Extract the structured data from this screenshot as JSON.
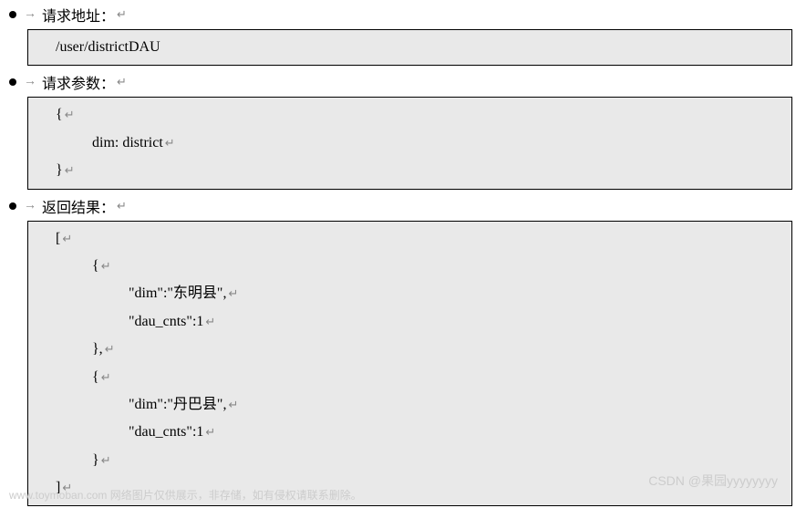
{
  "sections": [
    {
      "title": "请求地址：",
      "lines": [
        {
          "indent": 1,
          "text": "/user/districtDAU",
          "mark": ""
        }
      ]
    },
    {
      "title": "请求参数：",
      "lines": [
        {
          "indent": 1,
          "text": "{",
          "mark": "↵"
        },
        {
          "indent": 2,
          "text": "dim: district",
          "mark": "↵"
        },
        {
          "indent": 1,
          "text": "}",
          "mark": "↵"
        }
      ]
    },
    {
      "title": "返回结果：",
      "lines": [
        {
          "indent": 1,
          "text": "[",
          "mark": "↵"
        },
        {
          "indent": 2,
          "text": "{",
          "mark": "↵"
        },
        {
          "indent": 3,
          "text": "\"dim\":\"东明县\",",
          "mark": "↵"
        },
        {
          "indent": 3,
          "text": "\"dau_cnts\":1",
          "mark": "↵"
        },
        {
          "indent": 2,
          "text": "},",
          "mark": "↵"
        },
        {
          "indent": 2,
          "text": "{",
          "mark": "↵"
        },
        {
          "indent": 3,
          "text": "\"dim\":\"丹巴县\",",
          "mark": "↵"
        },
        {
          "indent": 3,
          "text": "\"dau_cnts\":1",
          "mark": "↵"
        },
        {
          "indent": 2,
          "text": "}",
          "mark": "↵"
        },
        {
          "indent": 1,
          "text": "]",
          "mark": "↵"
        }
      ]
    }
  ],
  "pmark": "↵",
  "arrow": "→",
  "watermark_left": "www.toymoban.com 网络图片仅供展示，非存储，如有侵权请联系删除。",
  "watermark_right": "CSDN @果园yyyyyyyy"
}
